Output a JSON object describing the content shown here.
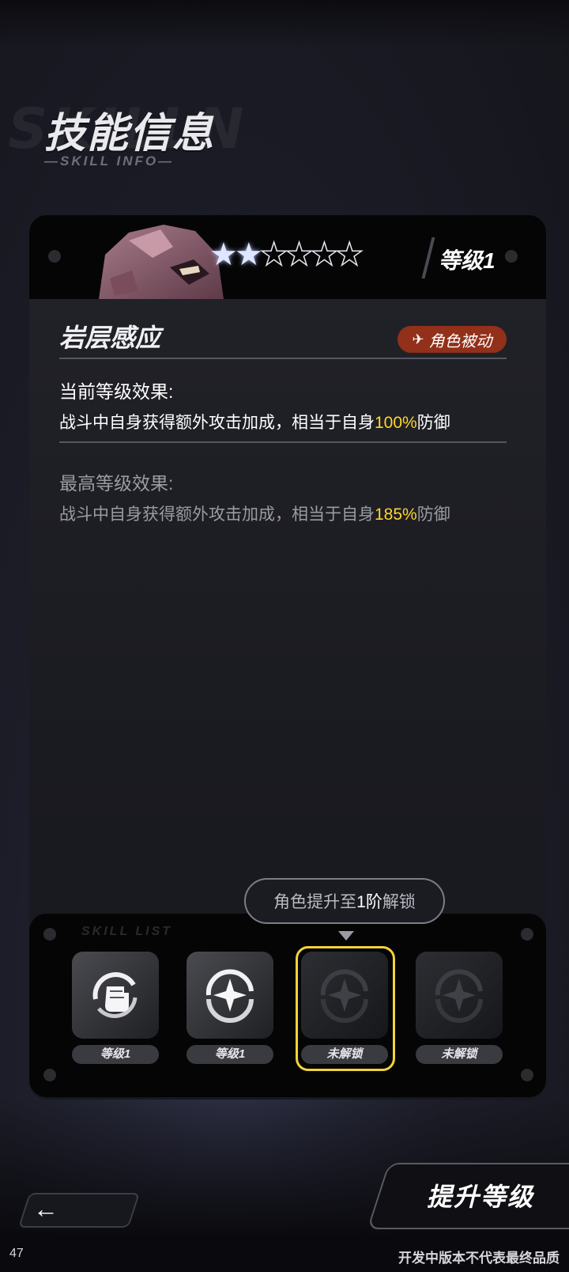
{
  "header": {
    "title": "技能信息",
    "subtitle": "—SKILL INFO—",
    "title_bg": "SKILLN"
  },
  "skill_card": {
    "stars_total": 6,
    "stars_filled": 2,
    "level_label": "等级1",
    "skill_name": "岩层感应",
    "badge_label": "角色被动",
    "current": {
      "label": "当前等级效果:",
      "text_prefix": "战斗中自身获得额外攻击加成，相当于自身",
      "value": "100%",
      "text_suffix": "防御"
    },
    "max": {
      "label": "最高等级效果:",
      "text_prefix": "战斗中自身获得额外攻击加成，相当于自身",
      "value": "185%",
      "text_suffix": "防御"
    }
  },
  "unlock_tip": {
    "prefix": "角色提升至",
    "strong": "1阶",
    "suffix": "解锁"
  },
  "skill_slots": {
    "panel_label": "SKILL LIST",
    "slots": [
      {
        "label": "等级1",
        "icon": "fist-swirl-icon",
        "locked": false
      },
      {
        "label": "等级1",
        "icon": "sparkle-ring-icon",
        "locked": false
      },
      {
        "label": "未解锁",
        "icon": "sparkle-ring-icon",
        "locked": true,
        "selected": true
      },
      {
        "label": "未解锁",
        "icon": "sparkle-ring-icon",
        "locked": true
      }
    ]
  },
  "controls": {
    "upgrade_label": "提升等级",
    "back_icon": "back-arrow-icon"
  },
  "footer": {
    "page_number": "47",
    "disclaimer": "开发中版本不代表最终品质"
  },
  "colors": {
    "highlight": "#ffd52e",
    "badge": "#93301a",
    "selected_border": "#f2d33a"
  }
}
